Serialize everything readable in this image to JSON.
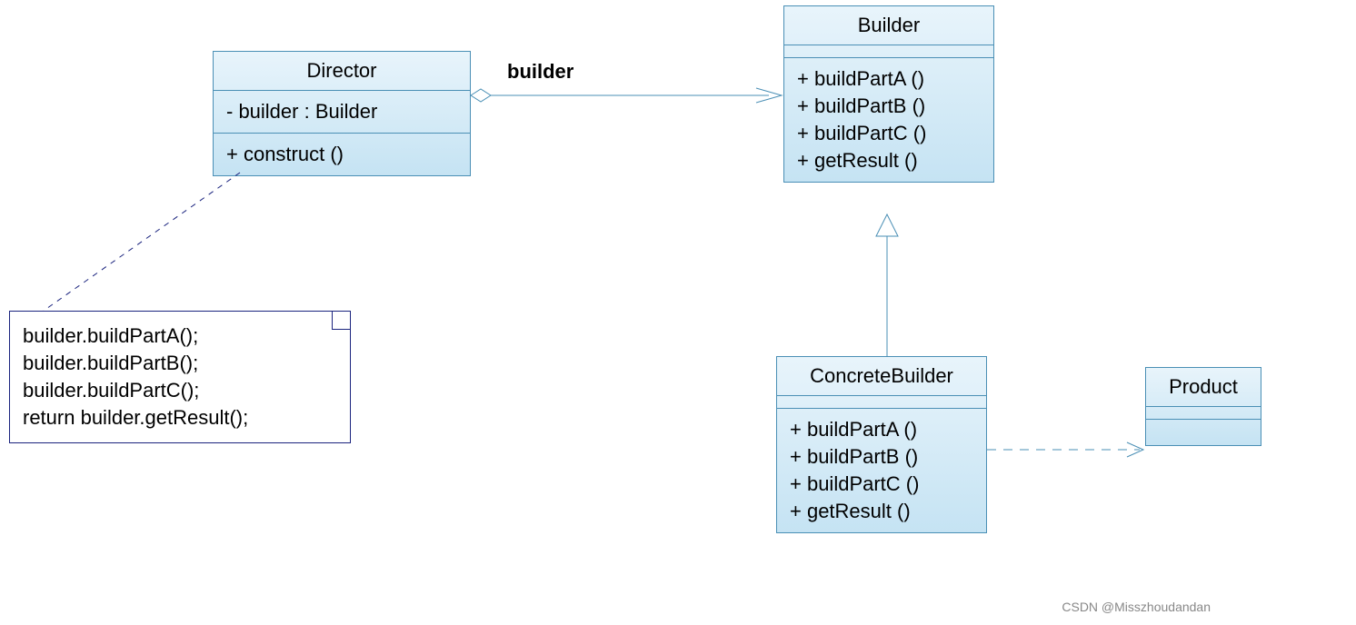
{
  "director": {
    "name": "Director",
    "attrs": [
      "- builder : Builder"
    ],
    "methods": [
      "+ construct ()"
    ]
  },
  "builder": {
    "name": "Builder",
    "methods": [
      "+ buildPartA ()",
      "+ buildPartB ()",
      "+ buildPartC ()",
      "+ getResult ()"
    ]
  },
  "concreteBuilder": {
    "name": "ConcreteBuilder",
    "methods": [
      "+ buildPartA ()",
      "+ buildPartB ()",
      "+ buildPartC ()",
      "+ getResult ()"
    ]
  },
  "product": {
    "name": "Product"
  },
  "note": {
    "lines": [
      "builder.buildPartA();",
      "builder.buildPartB();",
      "builder.buildPartC();",
      "return builder.getResult();"
    ]
  },
  "assocLabel": "builder",
  "watermark": "CSDN @Misszhoudandan"
}
